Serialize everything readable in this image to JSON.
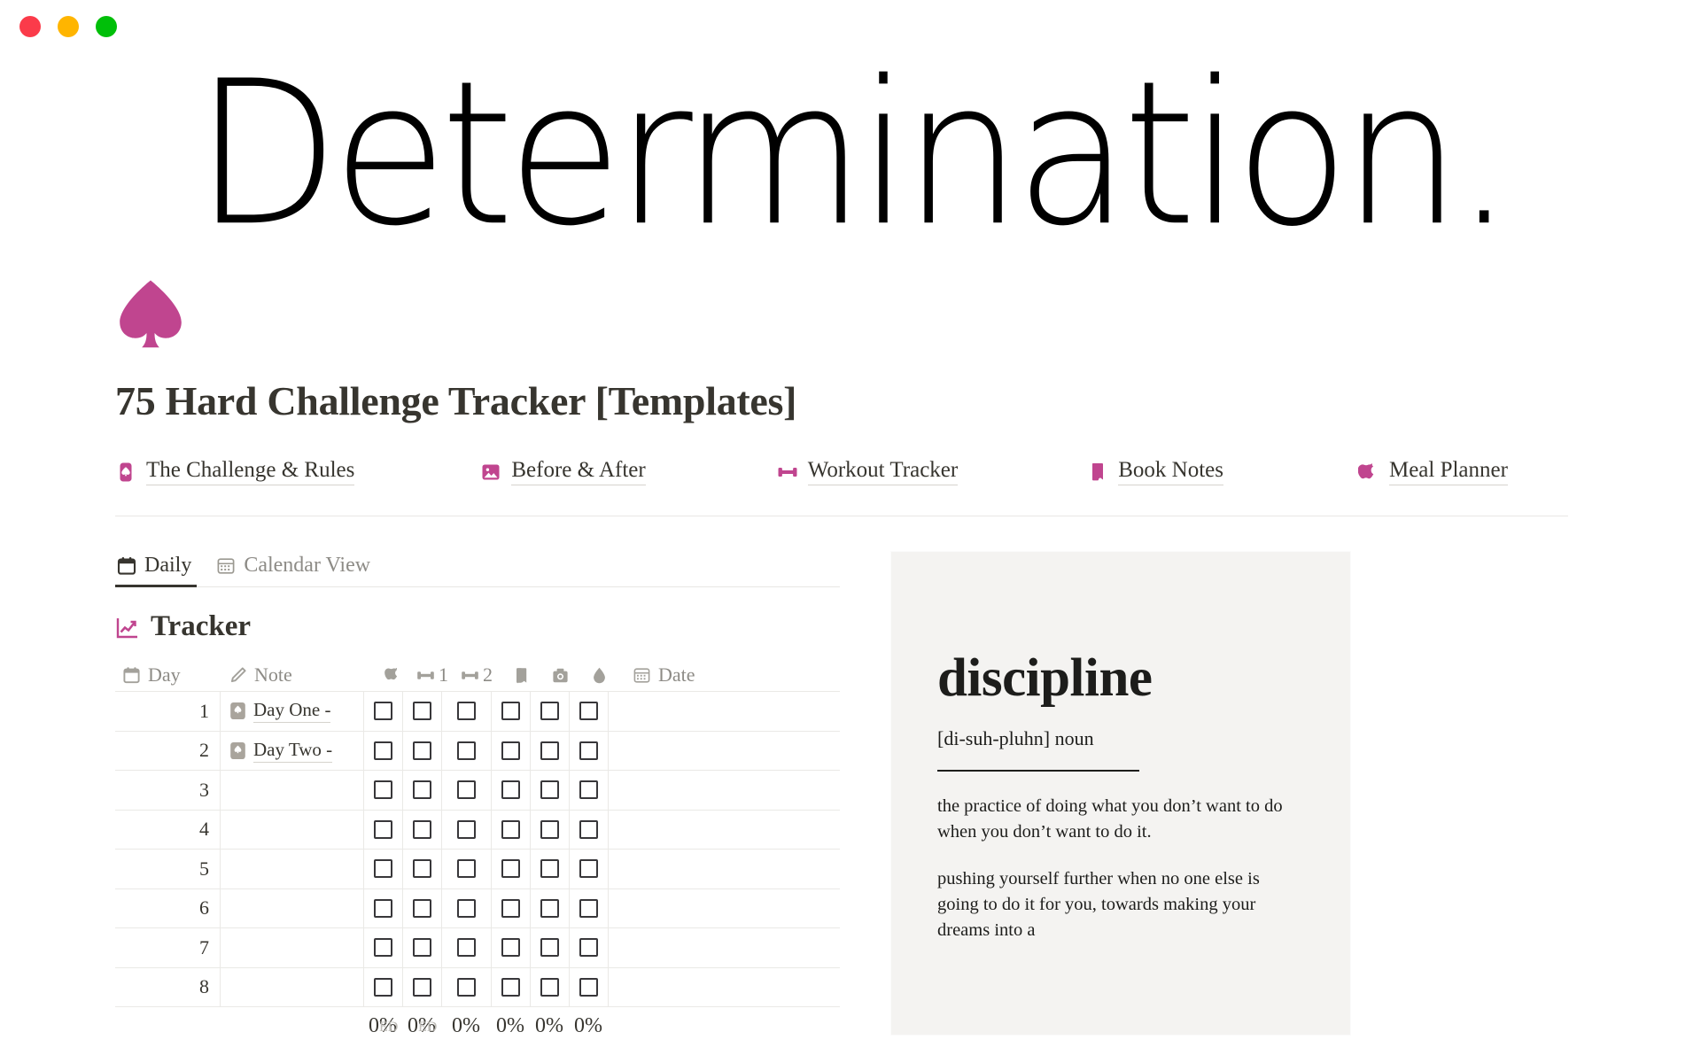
{
  "window": {
    "controls": [
      {
        "name": "close",
        "color": "#fb3b4a"
      },
      {
        "name": "minimize",
        "color": "#ffb500"
      },
      {
        "name": "maximize",
        "color": "#00bf09"
      }
    ]
  },
  "banner": {
    "text": "Determination."
  },
  "page": {
    "icon": "spade-icon",
    "title": "75 Hard Challenge Tracker [Templates]",
    "accent_color": "#c0458f"
  },
  "nav": {
    "items": [
      {
        "icon": "spade-card-icon",
        "label": "The Challenge & Rules"
      },
      {
        "icon": "image-icon",
        "label": "Before & After"
      },
      {
        "icon": "dumbbell-icon",
        "label": "Workout Tracker"
      },
      {
        "icon": "book-icon",
        "label": "Book Notes"
      },
      {
        "icon": "apple-icon",
        "label": "Meal Planner"
      }
    ]
  },
  "tabs": [
    {
      "icon": "calendar-icon",
      "label": "Daily",
      "active": true
    },
    {
      "icon": "calendar-grid-icon",
      "label": "Calendar View",
      "active": false
    }
  ],
  "tracker": {
    "icon": "chart-line-icon",
    "heading": "Tracker",
    "columns": [
      {
        "key": "day",
        "icon": "calendar-icon",
        "label": "Day"
      },
      {
        "key": "note",
        "icon": "pencil-icon",
        "label": "Note"
      },
      {
        "key": "diet",
        "icon": "apple-icon",
        "label": ""
      },
      {
        "key": "workout1",
        "icon": "dumbbell-icon",
        "label": "1"
      },
      {
        "key": "workout2",
        "icon": "dumbbell-icon",
        "label": "2"
      },
      {
        "key": "read",
        "icon": "book-icon",
        "label": ""
      },
      {
        "key": "photo",
        "icon": "camera-icon",
        "label": ""
      },
      {
        "key": "water",
        "icon": "water-drop-icon",
        "label": ""
      },
      {
        "key": "date",
        "icon": "calendar-grid-icon",
        "label": "Date"
      }
    ],
    "rows": [
      {
        "day": "1",
        "note": "Day One -",
        "note_icon": "spade-card-icon",
        "checks": [
          false,
          false,
          false,
          false,
          false,
          false
        ],
        "date": ""
      },
      {
        "day": "2",
        "note": "Day Two -",
        "note_icon": "spade-card-icon",
        "checks": [
          false,
          false,
          false,
          false,
          false,
          false
        ],
        "date": ""
      },
      {
        "day": "3",
        "note": "",
        "note_icon": "",
        "checks": [
          false,
          false,
          false,
          false,
          false,
          false
        ],
        "date": ""
      },
      {
        "day": "4",
        "note": "",
        "note_icon": "",
        "checks": [
          false,
          false,
          false,
          false,
          false,
          false
        ],
        "date": ""
      },
      {
        "day": "5",
        "note": "",
        "note_icon": "",
        "checks": [
          false,
          false,
          false,
          false,
          false,
          false
        ],
        "date": ""
      },
      {
        "day": "6",
        "note": "",
        "note_icon": "",
        "checks": [
          false,
          false,
          false,
          false,
          false,
          false
        ],
        "date": ""
      },
      {
        "day": "7",
        "note": "",
        "note_icon": "",
        "checks": [
          false,
          false,
          false,
          false,
          false,
          false
        ],
        "date": ""
      },
      {
        "day": "8",
        "note": "",
        "note_icon": "",
        "checks": [
          false,
          false,
          false,
          false,
          false,
          false
        ],
        "date": ""
      }
    ],
    "footer": {
      "percents": [
        "0%",
        "0%",
        "0%",
        "0%",
        "0%",
        "0%"
      ],
      "labels": [
        "ED",
        "ED"
      ]
    }
  },
  "definition_card": {
    "word": "discipline",
    "pronunciation": "[di-suh-pluhn] noun",
    "paragraphs": [
      "the practice of doing what you don’t want to do when you don’t want to do it.",
      "pushing yourself further when no one else is going to do it for you, towards making your dreams into a"
    ]
  }
}
